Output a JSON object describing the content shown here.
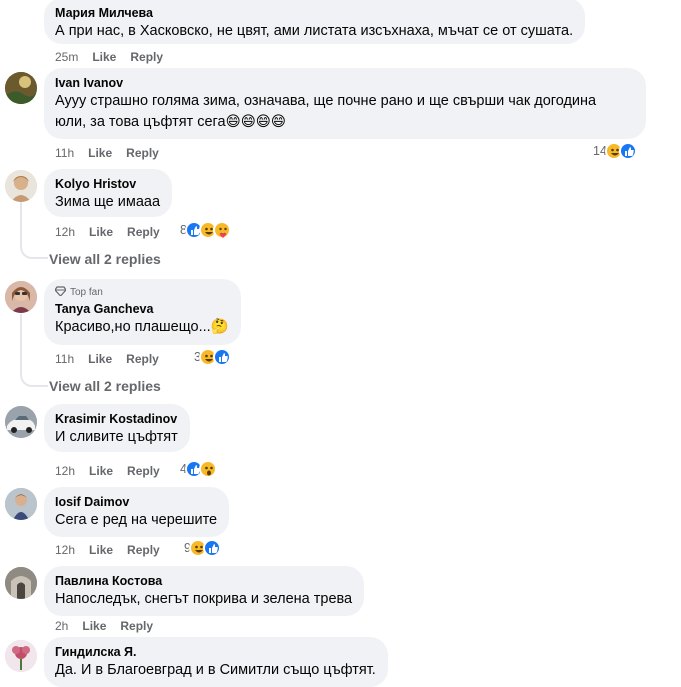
{
  "comments": [
    {
      "author": "Мария Милчева",
      "text": "А при нас, в Хасковско, не цвят, ами листата изсъхнаха, мъчат се от сушата.",
      "time": "25m",
      "like": "Like",
      "reply": "Reply"
    },
    {
      "author": "Ivan Ivanov",
      "text_line1": "Аууу страшно голяма зима, означава, ще почне рано и ще свърши чак догодина",
      "text_line2": "юли, за това цъфтят сега😄😄😄😄",
      "time": "11h",
      "like": "Like",
      "reply": "Reply",
      "reaction_count": "14",
      "reactions": [
        "haha",
        "like"
      ]
    },
    {
      "author": "Kolyo Hristov",
      "text": "Зима ще имааа",
      "time": "12h",
      "like": "Like",
      "reply": "Reply",
      "reaction_count": "8",
      "reactions": [
        "like",
        "haha",
        "care"
      ],
      "view_replies": "View all 2 replies"
    },
    {
      "badge": "Top fan",
      "author": "Tanya Gancheva",
      "text": "Красиво,но плашещо...🤔",
      "time": "11h",
      "like": "Like",
      "reply": "Reply",
      "reaction_count": "3",
      "reactions": [
        "haha",
        "like"
      ],
      "view_replies": "View all 2 replies"
    },
    {
      "author": "Krasimir Kostadinov",
      "text": "И сливите цъфтят",
      "time": "12h",
      "like": "Like",
      "reply": "Reply",
      "reaction_count": "4",
      "reactions": [
        "like",
        "wow"
      ]
    },
    {
      "author": "Iosif Daimov",
      "text": "Сега е ред на черешите",
      "time": "12h",
      "like": "Like",
      "reply": "Reply",
      "reaction_count": "9",
      "reactions": [
        "haha",
        "like"
      ]
    },
    {
      "author": "Павлина Костова",
      "text": "Напоследък, снегът покрива и зелена трева",
      "time": "2h",
      "like": "Like",
      "reply": "Reply"
    },
    {
      "author": "Гиндилска Я.",
      "text": "Да. И в Благоевград и в Симитли също цъфтят."
    }
  ],
  "colors": {
    "like": "#1877f2",
    "emoji": "#f7b928",
    "bubble": "#f0f2f5",
    "meta": "#65676b"
  }
}
